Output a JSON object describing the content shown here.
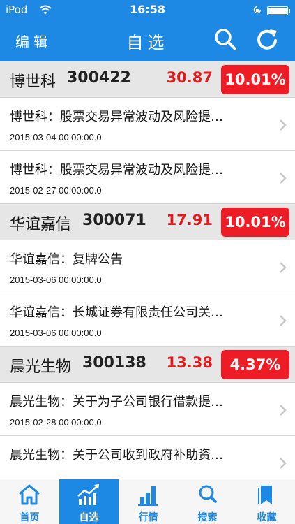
{
  "status_bar": {
    "carrier": "iPod",
    "time": "16:58"
  },
  "nav": {
    "edit_label": "编辑",
    "title": "自选"
  },
  "stocks": [
    {
      "name": "博世科",
      "code": "300422",
      "price": "30.87",
      "change": "10.01%",
      "news": [
        {
          "title": "博世科：股票交易异常波动及风险提…",
          "date": "2015-03-04 00:00:00.0"
        },
        {
          "title": "博世科：股票交易异常波动及风险提…",
          "date": "2015-02-27 00:00:00.0"
        }
      ]
    },
    {
      "name": "华谊嘉信",
      "code": "300071",
      "price": "17.91",
      "change": "10.01%",
      "news": [
        {
          "title": "华谊嘉信：复牌公告",
          "date": "2015-03-06 00:00:00.0"
        },
        {
          "title": "华谊嘉信：长城证券有限责任公司关…",
          "date": "2015-03-06 00:00:00.0"
        }
      ]
    },
    {
      "name": "晨光生物",
      "code": "300138",
      "price": "13.38",
      "change": "4.37%",
      "news": [
        {
          "title": "晨光生物：关于为子公司银行借款提…",
          "date": "2015-02-28 00:00:00.0"
        },
        {
          "title": "晨光生物：关于公司收到政府补助资…",
          "date": ""
        }
      ]
    }
  ],
  "tabs": [
    {
      "label": "首页",
      "icon": "home-icon"
    },
    {
      "label": "自选",
      "icon": "chart-trend-icon",
      "active": true
    },
    {
      "label": "行情",
      "icon": "bar-chart-icon"
    },
    {
      "label": "搜索",
      "icon": "search-icon"
    },
    {
      "label": "收藏",
      "icon": "bookmark-icon"
    }
  ],
  "colors": {
    "primary": "#1e88e5",
    "price_up": "#e01b1b",
    "badge_up": "#ee1c24"
  }
}
